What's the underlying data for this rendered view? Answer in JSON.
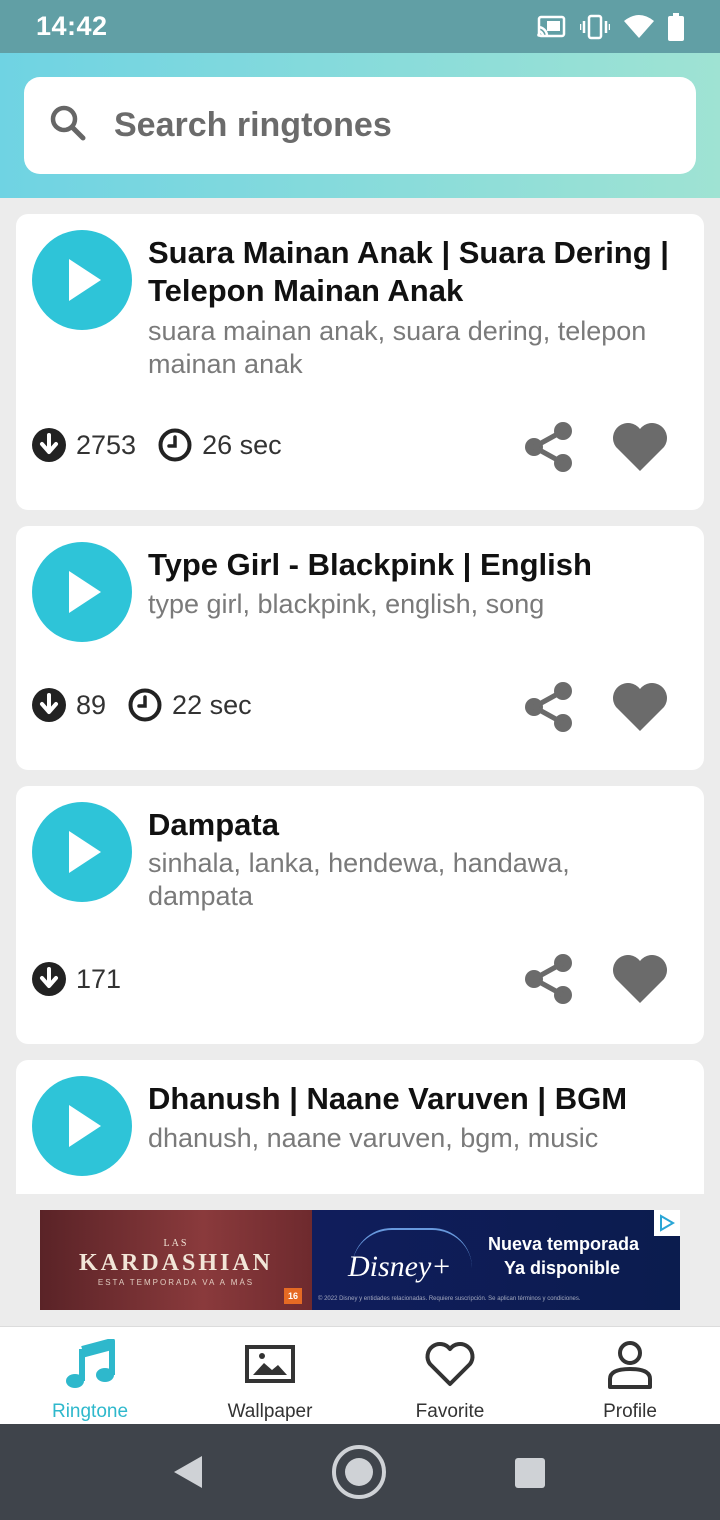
{
  "status_bar": {
    "time": "14:42",
    "icons": [
      "cast-icon",
      "vibrate-icon",
      "wifi-icon",
      "battery-icon"
    ]
  },
  "search": {
    "placeholder": "Search ringtones",
    "value": ""
  },
  "ringtones": [
    {
      "title": "Suara Mainan Anak | Suara Dering | Telepon Mainan Anak",
      "tags": "suara mainan anak, suara dering, telepon mainan anak",
      "downloads": "2753",
      "duration": "26 sec"
    },
    {
      "title": "Type Girl - Blackpink | English",
      "tags": "type girl, blackpink, english, song",
      "downloads": "89",
      "duration": "22 sec"
    },
    {
      "title": "Dampata",
      "tags": "sinhala, lanka, hendewa, handawa, dampata",
      "downloads": "171"
    },
    {
      "title": "Dhanush | Naane Varuven | BGM",
      "tags": "dhanush, naane varuven, bgm, music"
    }
  ],
  "ad": {
    "left_small": "LAS",
    "left_big": "KARDASHIAN",
    "left_tag": "ESTA TEMPORADA VA A MÁS",
    "left_badge": "16",
    "right_brand": "Disney+",
    "right_line1": "Nueva temporada",
    "right_line2": "Ya disponible",
    "right_fine": "© 2022 Disney y entidades relacionadas. Requiere suscripción. Se aplican términos y condiciones."
  },
  "bottom_nav": {
    "items": [
      {
        "label": "Ringtone",
        "icon": "music-note-icon",
        "active": true
      },
      {
        "label": "Wallpaper",
        "icon": "image-icon",
        "active": false
      },
      {
        "label": "Favorite",
        "icon": "heart-outline-icon",
        "active": false
      },
      {
        "label": "Profile",
        "icon": "person-icon",
        "active": false
      }
    ]
  },
  "colors": {
    "accent": "#2ec4d8",
    "status_bar": "#619fa5",
    "header_gradient_start": "#6fd3e3",
    "header_gradient_end": "#9fe3d3",
    "icon_gray": "#6b6b6b",
    "system_nav": "#3f444b"
  }
}
